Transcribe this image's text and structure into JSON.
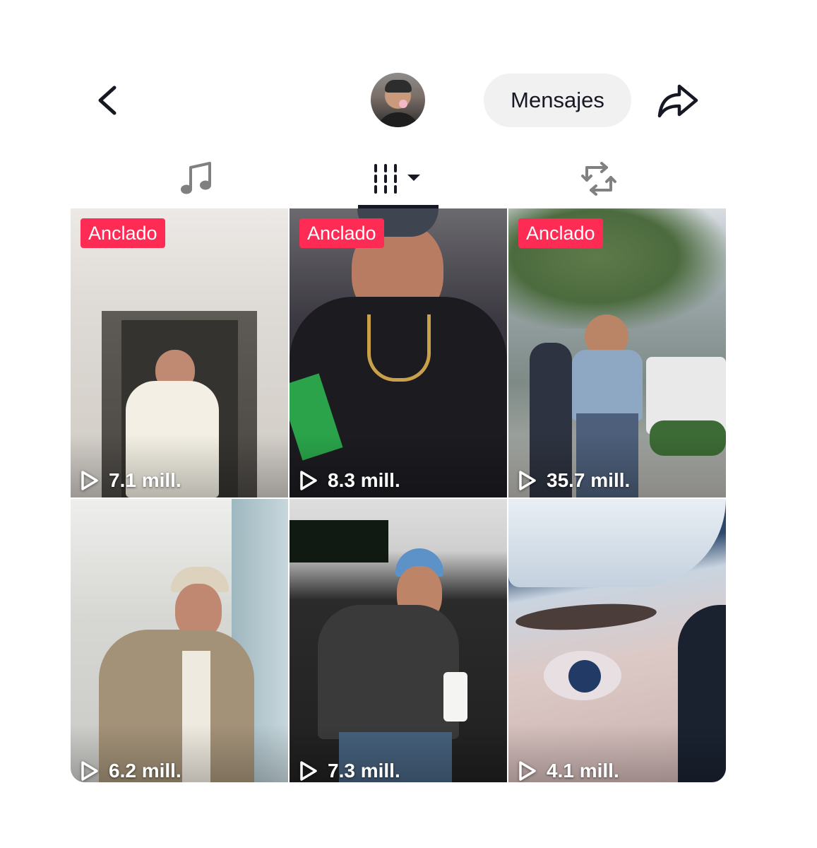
{
  "header": {
    "back_icon": "chevron-left-icon",
    "avatar_icon": "profile-avatar",
    "messages_label": "Mensajes",
    "share_icon": "share-arrow-icon"
  },
  "tabs": [
    {
      "icon": "music-note-icon",
      "active": false
    },
    {
      "icon": "video-grid-sort-icon",
      "active": true
    },
    {
      "icon": "repost-icon",
      "active": false
    }
  ],
  "videos": [
    {
      "pinned_label": "Anclado",
      "views": "7.1 mill."
    },
    {
      "pinned_label": "Anclado",
      "views": "8.3 mill."
    },
    {
      "pinned_label": "Anclado",
      "views": "35.7 mill."
    },
    {
      "pinned_label": "",
      "views": "6.2 mill."
    },
    {
      "pinned_label": "",
      "views": "7.3 mill."
    },
    {
      "pinned_label": "",
      "views": "4.1 mill."
    }
  ],
  "colors": {
    "accent": "#fe2c55",
    "text": "#161823",
    "button_bg": "#f1f1f2",
    "background": "#ffffff"
  }
}
